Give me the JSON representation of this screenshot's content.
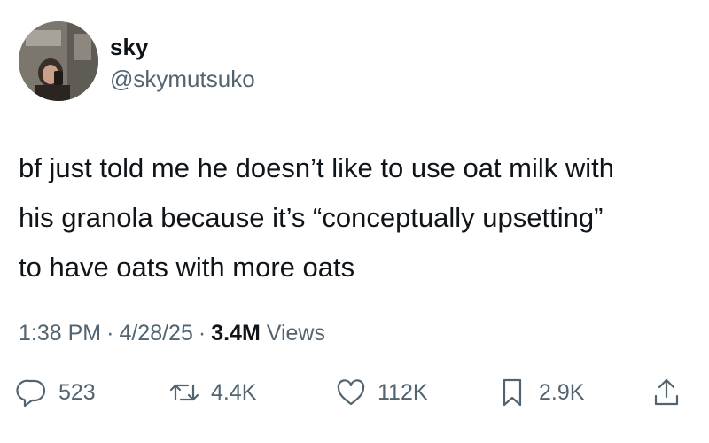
{
  "author": {
    "display_name": "sky",
    "handle": "@skymutsuko"
  },
  "tweet": {
    "lines": [
      "bf just told me he doesn’t like to use oat milk with",
      "his granola because it’s “conceptually upsetting”",
      "to have oats with more oats"
    ]
  },
  "meta": {
    "time": "1:38 PM",
    "separator": "·",
    "date": "4/28/25",
    "views_count": "3.4M",
    "views_label": "Views"
  },
  "actions": {
    "replies": "523",
    "reposts": "4.4K",
    "likes": "112K",
    "bookmarks": "2.9K"
  },
  "icons": {
    "reply": "reply-icon",
    "repost": "repost-icon",
    "like": "heart-icon",
    "bookmark": "bookmark-icon",
    "share": "share-icon"
  },
  "colors": {
    "text": "#0f1419",
    "secondary": "#536471",
    "background": "#ffffff"
  }
}
